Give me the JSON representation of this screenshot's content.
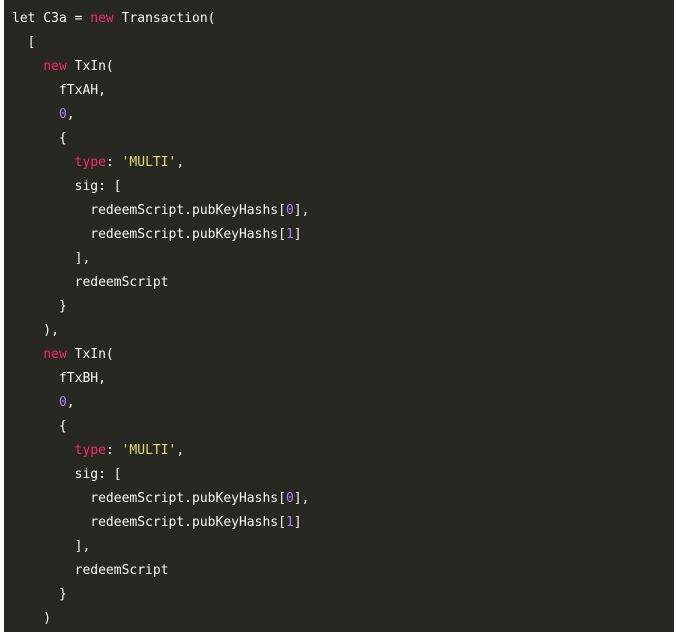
{
  "code": {
    "colors": {
      "background": "#272822",
      "plain": "#f8f8f2",
      "keyword": "#f92672",
      "number": "#ae81ff",
      "string": "#e6db74"
    },
    "lines": [
      [
        {
          "t": "let C3a = ",
          "c": "plain"
        },
        {
          "t": "new",
          "c": "kw"
        },
        {
          "t": " Transaction(",
          "c": "plain"
        }
      ],
      [
        {
          "t": "  [",
          "c": "plain"
        }
      ],
      [
        {
          "t": "    ",
          "c": "plain"
        },
        {
          "t": "new",
          "c": "kw"
        },
        {
          "t": " TxIn(",
          "c": "plain"
        }
      ],
      [
        {
          "t": "      fTxAH,",
          "c": "plain"
        }
      ],
      [
        {
          "t": "      ",
          "c": "plain"
        },
        {
          "t": "0",
          "c": "num"
        },
        {
          "t": ",",
          "c": "plain"
        }
      ],
      [
        {
          "t": "      {",
          "c": "plain"
        }
      ],
      [
        {
          "t": "        ",
          "c": "plain"
        },
        {
          "t": "type",
          "c": "kw"
        },
        {
          "t": ": ",
          "c": "plain"
        },
        {
          "t": "'MULTI'",
          "c": "str"
        },
        {
          "t": ",",
          "c": "plain"
        }
      ],
      [
        {
          "t": "        sig: [",
          "c": "plain"
        }
      ],
      [
        {
          "t": "          redeemScript.pubKeyHashs[",
          "c": "plain"
        },
        {
          "t": "0",
          "c": "num"
        },
        {
          "t": "],",
          "c": "plain"
        }
      ],
      [
        {
          "t": "          redeemScript.pubKeyHashs[",
          "c": "plain"
        },
        {
          "t": "1",
          "c": "num"
        },
        {
          "t": "]",
          "c": "plain"
        }
      ],
      [
        {
          "t": "        ],",
          "c": "plain"
        }
      ],
      [
        {
          "t": "        redeemScript",
          "c": "plain"
        }
      ],
      [
        {
          "t": "      }",
          "c": "plain"
        }
      ],
      [
        {
          "t": "    ),",
          "c": "plain"
        }
      ],
      [
        {
          "t": "    ",
          "c": "plain"
        },
        {
          "t": "new",
          "c": "kw"
        },
        {
          "t": " TxIn(",
          "c": "plain"
        }
      ],
      [
        {
          "t": "      fTxBH,",
          "c": "plain"
        }
      ],
      [
        {
          "t": "      ",
          "c": "plain"
        },
        {
          "t": "0",
          "c": "num"
        },
        {
          "t": ",",
          "c": "plain"
        }
      ],
      [
        {
          "t": "      {",
          "c": "plain"
        }
      ],
      [
        {
          "t": "        ",
          "c": "plain"
        },
        {
          "t": "type",
          "c": "kw"
        },
        {
          "t": ": ",
          "c": "plain"
        },
        {
          "t": "'MULTI'",
          "c": "str"
        },
        {
          "t": ",",
          "c": "plain"
        }
      ],
      [
        {
          "t": "        sig: [",
          "c": "plain"
        }
      ],
      [
        {
          "t": "          redeemScript.pubKeyHashs[",
          "c": "plain"
        },
        {
          "t": "0",
          "c": "num"
        },
        {
          "t": "],",
          "c": "plain"
        }
      ],
      [
        {
          "t": "          redeemScript.pubKeyHashs[",
          "c": "plain"
        },
        {
          "t": "1",
          "c": "num"
        },
        {
          "t": "]",
          "c": "plain"
        }
      ],
      [
        {
          "t": "        ],",
          "c": "plain"
        }
      ],
      [
        {
          "t": "        redeemScript",
          "c": "plain"
        }
      ],
      [
        {
          "t": "      }",
          "c": "plain"
        }
      ],
      [
        {
          "t": "    )",
          "c": "plain"
        }
      ]
    ]
  }
}
